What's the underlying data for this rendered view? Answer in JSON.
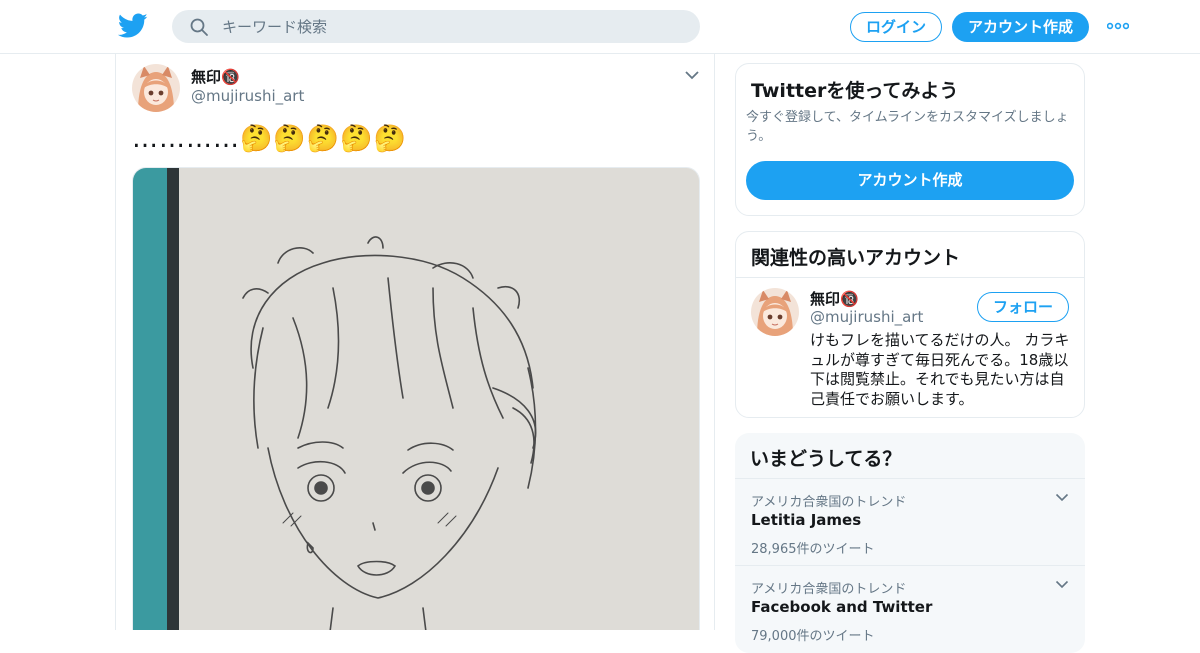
{
  "header": {
    "search_placeholder": "キーワード検索",
    "login_label": "ログイン",
    "signup_label": "アカウント作成"
  },
  "tweet": {
    "author_name": "無印🔞",
    "author_handle": "@mujirushi_art",
    "text": "…………🤔🤔🤔🤔🤔"
  },
  "promo": {
    "title": "Twitterを使ってみよう",
    "description": "今すぐ登録して、タイムラインをカスタマイズしましょう。",
    "button_label": "アカウント作成"
  },
  "related": {
    "title": "関連性の高いアカウント",
    "account": {
      "name": "無印🔞",
      "handle": "@mujirushi_art",
      "follow_label": "フォロー",
      "bio": "けもフレを描いてるだけの人。 カラキュルが尊すぎて毎日死んでる。18歳以下は閲覧禁止。それでも見たい方は自己責任でお願いします。"
    }
  },
  "trends": {
    "title": "いまどうしてる？",
    "items": [
      {
        "location": "アメリカ合衆国のトレンド",
        "name": "Letitia James",
        "count": "28,965件のツイート"
      },
      {
        "location": "アメリカ合衆国のトレンド",
        "name": "Facebook and Twitter",
        "count": "79,000件のツイート"
      }
    ]
  },
  "colors": {
    "brand": "#1da1f2",
    "text_primary": "#14171a",
    "text_secondary": "#657786",
    "border": "#e6ecf0",
    "panel_bg": "#f5f8fa"
  }
}
